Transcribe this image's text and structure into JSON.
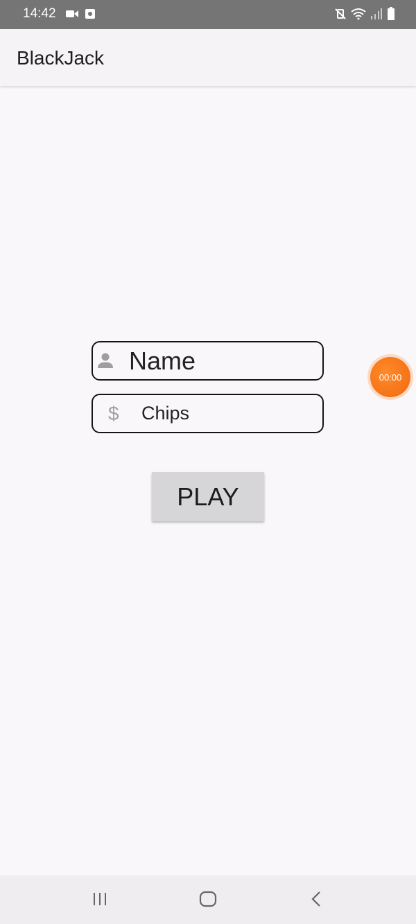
{
  "status_bar": {
    "time": "14:42",
    "icons_left": [
      "video-icon",
      "screen-record-icon"
    ],
    "icons_right": [
      "mute-vibrate-icon",
      "wifi-icon",
      "signal-icon",
      "battery-icon"
    ]
  },
  "app_bar": {
    "title": "BlackJack"
  },
  "form": {
    "name_field": {
      "placeholder": "Name",
      "icon": "person-icon"
    },
    "chips_field": {
      "placeholder": "Chips",
      "icon_glyph": "$",
      "icon": "dollar-icon"
    },
    "play_label": "PLAY"
  },
  "overlay": {
    "timer": "00:00",
    "color": "#f57516"
  },
  "nav_bar": {
    "buttons": [
      "recent-apps-icon",
      "home-icon",
      "back-icon"
    ]
  }
}
